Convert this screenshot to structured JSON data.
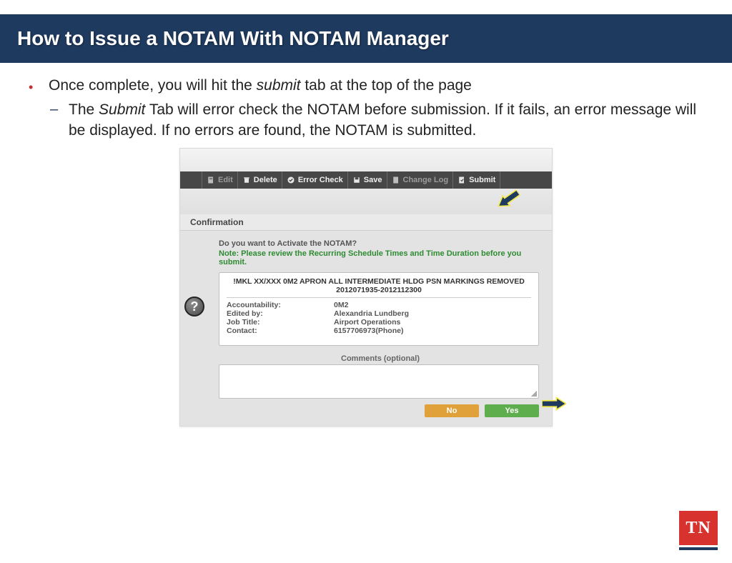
{
  "slide": {
    "title": "How to Issue a NOTAM With NOTAM Manager",
    "bullet_pre": "Once complete, you will hit the ",
    "bullet_em": "submit",
    "bullet_post": " tab at the top of the page",
    "sub_pre": "The ",
    "sub_em": "Submit",
    "sub_post": " Tab will error check the NOTAM before submission. If it fails, an error message will be displayed. If no errors are found, the NOTAM is submitted."
  },
  "toolbar": {
    "edit": "Edit",
    "delete": "Delete",
    "error_check": "Error Check",
    "save": "Save",
    "change_log": "Change Log",
    "submit": "Submit"
  },
  "confirmation": {
    "heading": "Confirmation",
    "question": "Do you want to Activate the NOTAM?",
    "note": "Note: Please review the Recurring Schedule Times and Time Duration before you submit.",
    "notam_text": "!MKL XX/XXX 0M2 APRON ALL INTERMEDIATE HLDG PSN MARKINGS REMOVED",
    "notam_dates": "2012071935-2012112300",
    "fields": {
      "accountability_k": "Accountability:",
      "accountability_v": "0M2",
      "edited_by_k": "Edited by:",
      "edited_by_v": "Alexandria Lundberg",
      "job_title_k": "Job Title:",
      "job_title_v": "Airport Operations",
      "contact_k": "Contact:",
      "contact_v": "6157706973(Phone)"
    },
    "comments_label": "Comments (optional)",
    "no_btn": "No",
    "yes_btn": "Yes",
    "help": "?"
  },
  "logo": {
    "text": "TN"
  }
}
